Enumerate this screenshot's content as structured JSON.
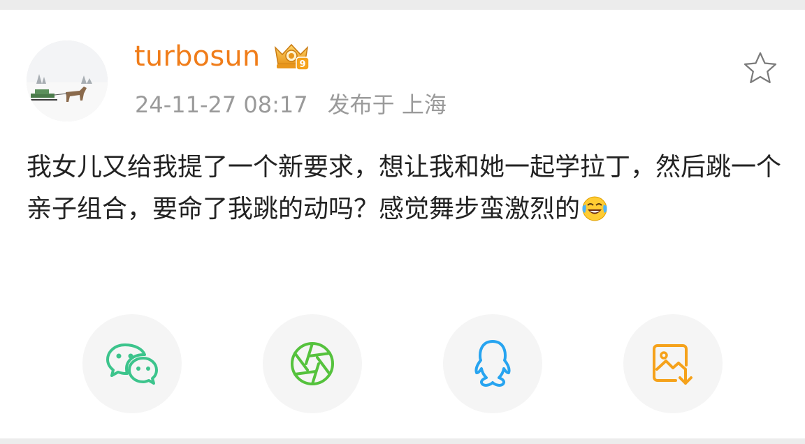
{
  "post": {
    "username": "turbosun",
    "timestamp": "24-11-27 08:17",
    "location": "发布于 上海",
    "content": "我女儿又给我提了一个新要求，想让我和她一起学拉丁，然后跳一个亲子组合，要命了我跳的动吗？感觉舞步蛮激烈的",
    "emoji": "laughing-crying-emoji"
  },
  "badge": {
    "level_text": "9"
  },
  "icons": {
    "favorite": "star-outline-icon",
    "share": [
      "wechat-icon",
      "moments-icon",
      "qq-icon",
      "save-image-icon"
    ]
  },
  "colors": {
    "username": "#f07d1a",
    "meta": "#9a9a9a",
    "wechat": "#3cc48c",
    "moments": "#55c23d",
    "qq": "#27a4f0",
    "save_image": "#f5a21b"
  }
}
